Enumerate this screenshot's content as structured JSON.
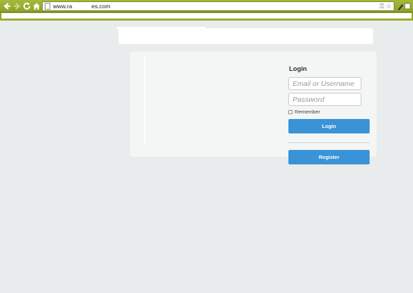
{
  "browser": {
    "url_start": "www.ra",
    "url_end": "es.com"
  },
  "login": {
    "title": "Login",
    "username_placeholder": "Email or Username",
    "password_placeholder": "Password",
    "remember_label": "Remember",
    "login_label": "Login",
    "register_label": "Register"
  },
  "colors": {
    "chrome_green": "#9db02e",
    "button_blue": "#3a93d6",
    "page_bg": "#e8eced"
  }
}
